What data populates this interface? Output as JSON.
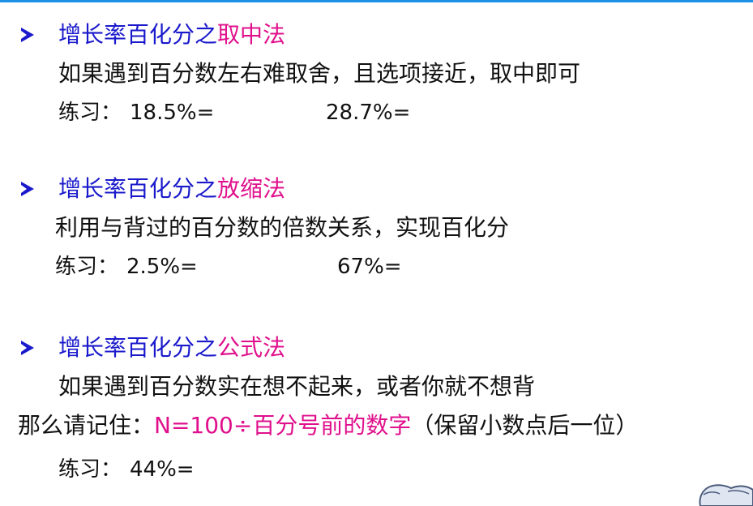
{
  "sections": [
    {
      "heading_prefix": "增长率百化分之",
      "heading_method": "取中法",
      "description": "如果遇到百分数左右难取舍，且选项接近，取中即可",
      "practice_label": "练习：",
      "practice_items": [
        "18.5%=",
        "28.7%="
      ]
    },
    {
      "heading_prefix": "增长率百化分之",
      "heading_method": "放缩法",
      "description": "利用与背过的百分数的倍数关系，实现百化分",
      "practice_label": "练习：",
      "practice_items": [
        "2.5%=",
        "67%="
      ]
    },
    {
      "heading_prefix": "增长率百化分之",
      "heading_method": "公式法",
      "description": "如果遇到百分数实在想不起来，或者你就不想背",
      "formula_prefix": "那么请记住：",
      "formula": "N=100÷百分号前的数字",
      "formula_note": "（保留小数点后一位）",
      "practice_label": "练习：",
      "practice_items": [
        "44%="
      ]
    }
  ],
  "colors": {
    "heading": "#1a1acc",
    "accent": "#e0108c",
    "top_rule": "#1e90e6"
  }
}
